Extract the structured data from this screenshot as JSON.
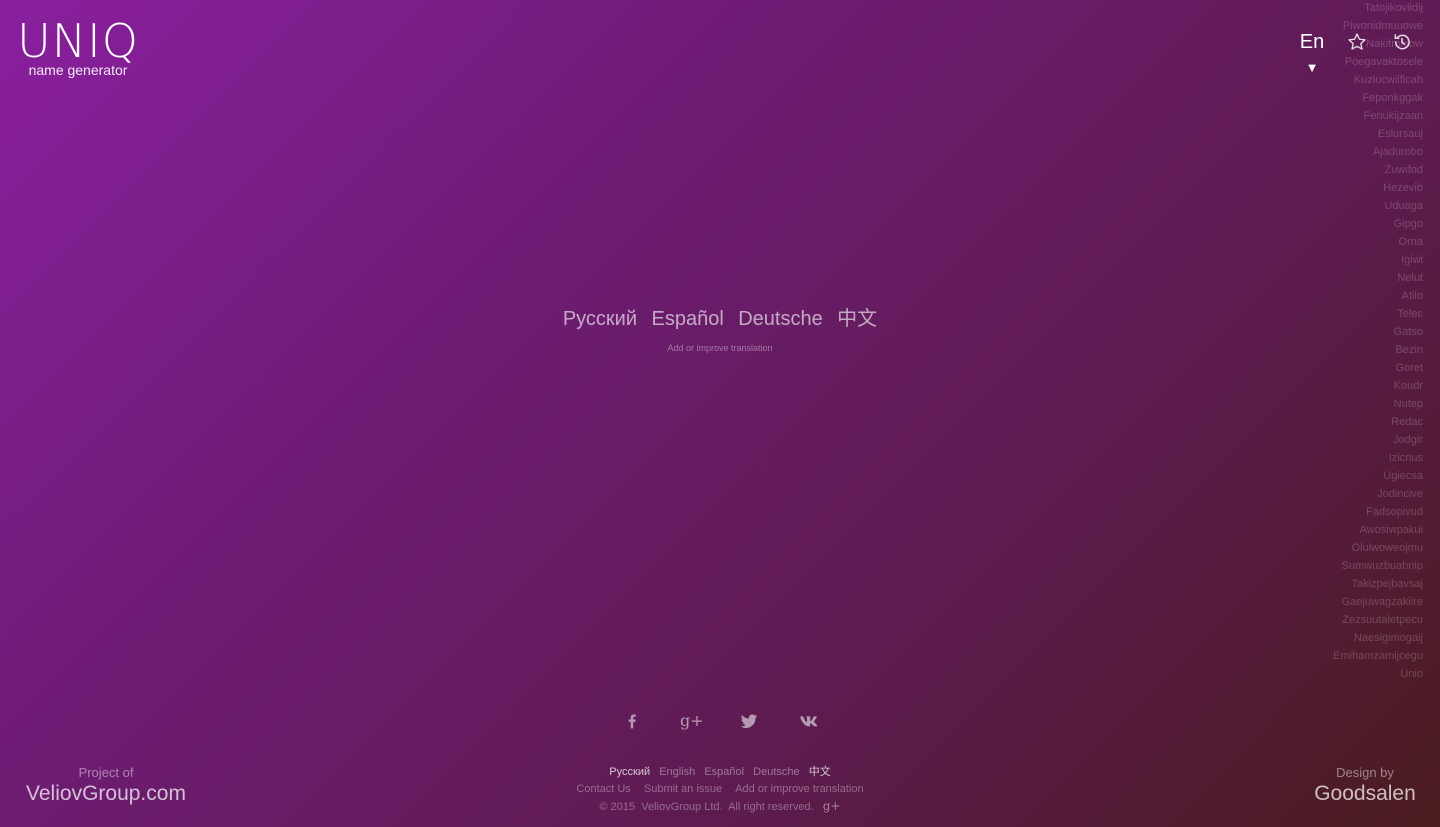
{
  "logo": {
    "title": "UNIQ",
    "subtitle": "name generator"
  },
  "header": {
    "language": "En",
    "language_arrow": "▼",
    "favorites_icon": "star-outline-icon",
    "history_icon": "history-icon"
  },
  "names": [
    "Tatojikoviidij",
    "Piwonidmuuowe",
    "Nakitmhlow",
    "Poegavaktosele",
    "Kuzlucwiificah",
    "Feponkggak",
    "Fenukijzaan",
    "Eslursauj",
    "Ajadurobo",
    "Zuwifod",
    "Hezevib",
    "Uduaga",
    "Gipgo",
    "Orna",
    "Igiwi",
    "Nelut",
    "Atilo",
    "Telec",
    "Gatso",
    "Bezin",
    "Goret",
    "Koudr",
    "Nutep",
    "Redac",
    "Jodgir",
    "Izicnus",
    "Ugiecsa",
    "Jodincive",
    "Fadsopivud",
    "Awosiwpakui",
    "Olulwoweojmu",
    "Sumwuzbuahnip",
    "Takizpejbavsaj",
    "Gaejuwagzakiire",
    "Zezsuutaletpecu",
    "Naesigimogaij",
    "Emihamzamijcegu",
    "Unio"
  ],
  "center": {
    "languages": [
      "Русский",
      "Español",
      "Deutsche",
      "中文"
    ],
    "translate_link": "Add or improve translation"
  },
  "social": {
    "facebook": "facebook-icon",
    "googleplus_label": "g+",
    "twitter": "twitter-icon",
    "vk": "vk-icon"
  },
  "footer": {
    "left": {
      "caption": "Project of",
      "link": "VeliovGroup.com"
    },
    "right": {
      "caption": "Design by",
      "link": "Goodsalen"
    },
    "languages": [
      "Русский",
      "English",
      "Español",
      "Deutsche",
      "中文"
    ],
    "links": [
      "Contact Us",
      "Submit an issue",
      "Add or improve translation"
    ],
    "copyright": "© 2015  VeliovGroup Ltd.  All right reserved.",
    "googleplus_label": "g+"
  }
}
